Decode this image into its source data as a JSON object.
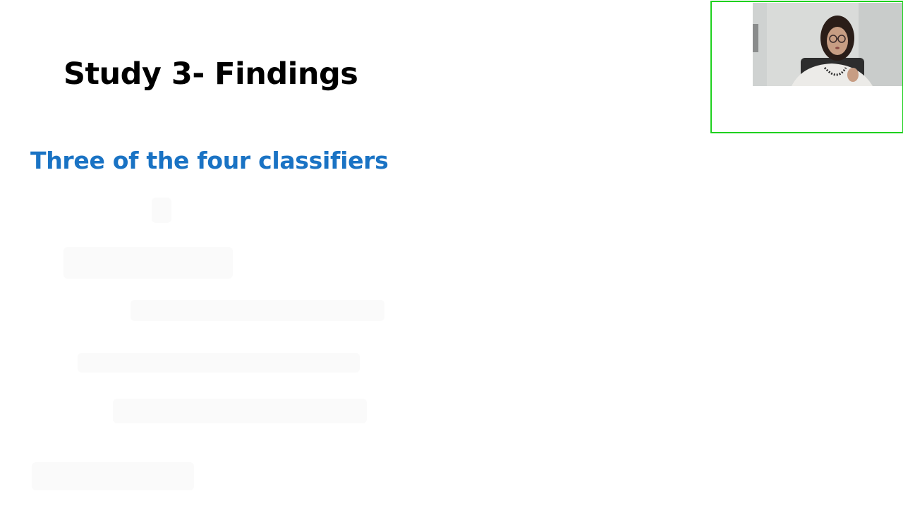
{
  "slide": {
    "title": "Study 3- Findings",
    "subtitle": "Three of the four classifiers"
  },
  "video": {
    "participant_state": "active-speaker",
    "border_color": "#1fd11f"
  },
  "colors": {
    "accent": "#1a73c4",
    "title": "#000000",
    "background": "#ffffff"
  },
  "icons": {
    "participant": "person-video-thumbnail"
  }
}
